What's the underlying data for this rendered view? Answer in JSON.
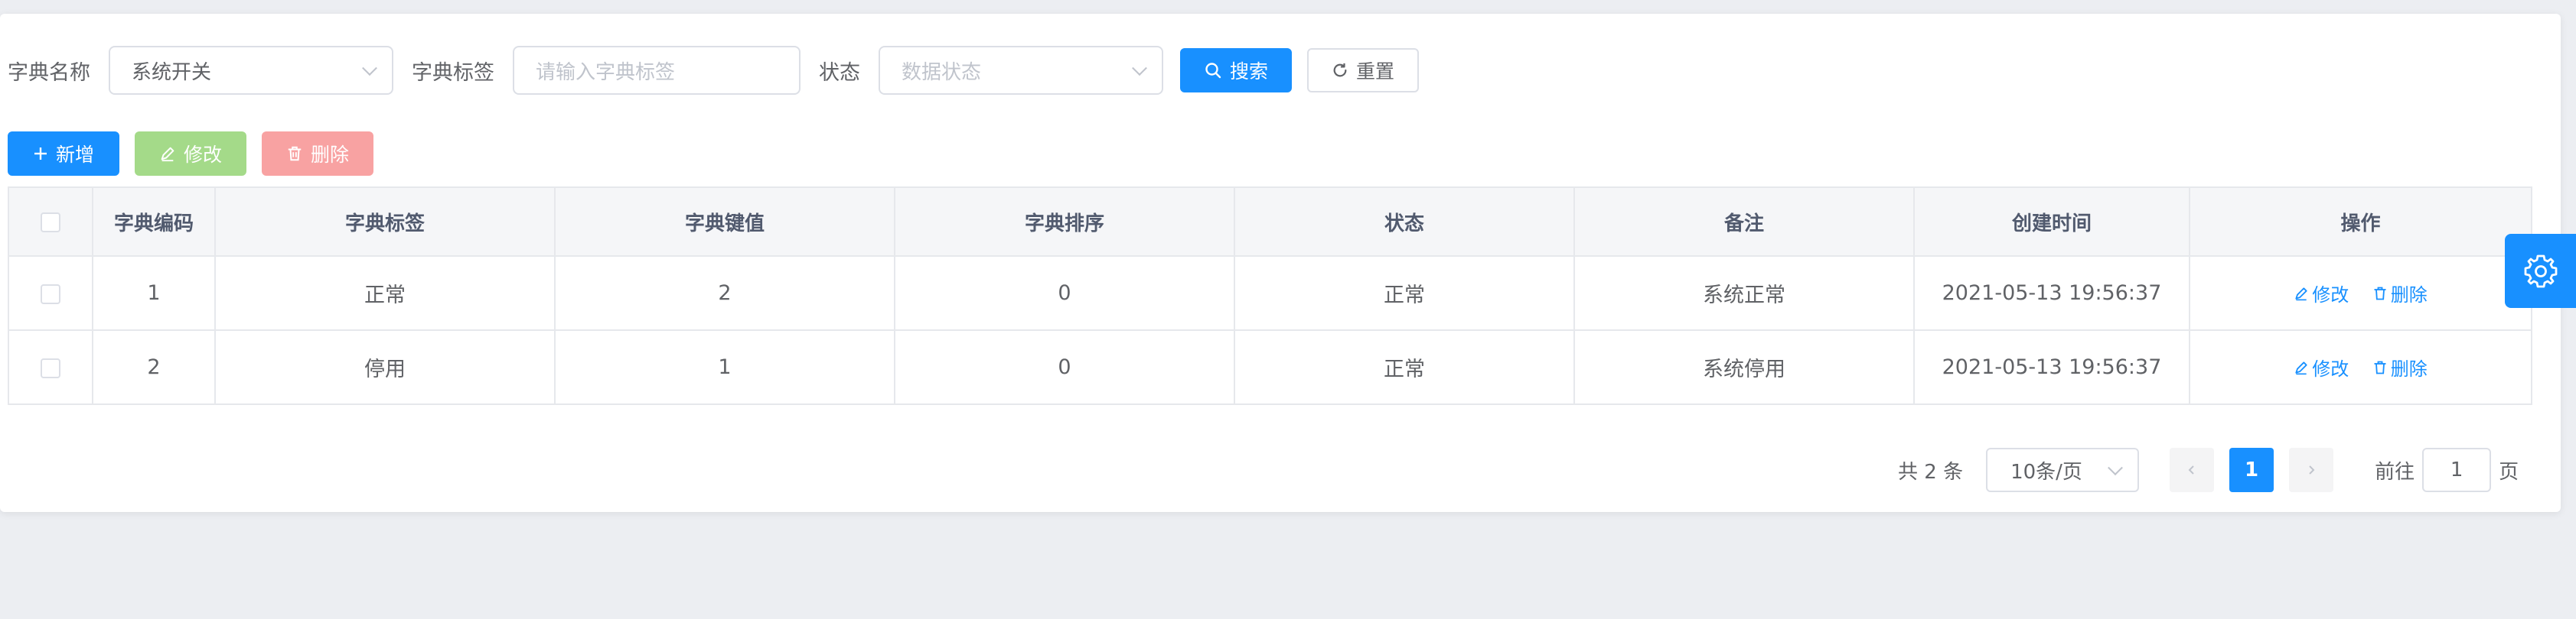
{
  "search": {
    "dict_name_label": "字典名称",
    "dict_name_value": "系统开关",
    "dict_label_label": "字典标签",
    "dict_label_placeholder": "请输入字典标签",
    "status_label": "状态",
    "status_placeholder": "数据状态",
    "search_button": "搜索",
    "reset_button": "重置"
  },
  "toolbar": {
    "add_label": "新增",
    "edit_label": "修改",
    "delete_label": "删除"
  },
  "table": {
    "columns": [
      "字典编码",
      "字典标签",
      "字典键值",
      "字典排序",
      "状态",
      "备注",
      "创建时间",
      "操作"
    ],
    "rows": [
      {
        "code": "1",
        "label": "正常",
        "value": "2",
        "sort": "0",
        "status": "正常",
        "remark": "系统正常",
        "created": "2021-05-13 19:56:37"
      },
      {
        "code": "2",
        "label": "停用",
        "value": "1",
        "sort": "0",
        "status": "正常",
        "remark": "系统停用",
        "created": "2021-05-13 19:56:37"
      }
    ],
    "row_edit_label": "修改",
    "row_delete_label": "删除"
  },
  "pagination": {
    "total_text": "共 2 条",
    "page_size": "10条/页",
    "current_page": "1",
    "goto_prefix": "前往",
    "goto_value": "1",
    "goto_suffix": "页"
  },
  "colors": {
    "primary": "#1890ff",
    "success_disabled": "#95d475",
    "danger_disabled": "#f89898"
  },
  "icons": [
    "search-icon",
    "refresh-icon",
    "plus-icon",
    "edit-icon",
    "trash-icon",
    "chevron-down-icon",
    "chevron-left-icon",
    "chevron-right-icon",
    "gear-icon"
  ]
}
